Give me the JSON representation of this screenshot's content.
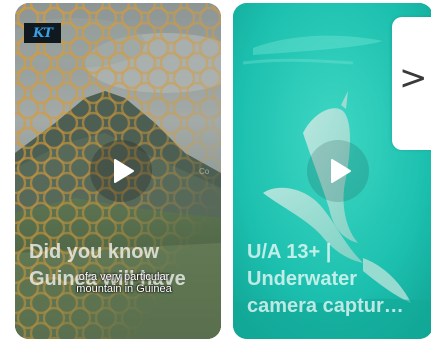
{
  "cards": [
    {
      "title_line1": "Did you know",
      "title_line2": "Guinea will have",
      "caption_line1": "of a very particular",
      "caption_line2": "mountain in Guinea",
      "watermark": "Co"
    },
    {
      "title_line1": "U/A 13+ |",
      "title_line2": "Underwater",
      "title_line3": "camera captur…"
    }
  ],
  "next_button": {
    "label": ">"
  },
  "colors": {
    "ocean": "#16b8a6",
    "logo_text": "#3aa0e8"
  },
  "icons": {
    "play": "play-icon",
    "next": "chevron-right-icon",
    "logo": "channel-logo"
  }
}
